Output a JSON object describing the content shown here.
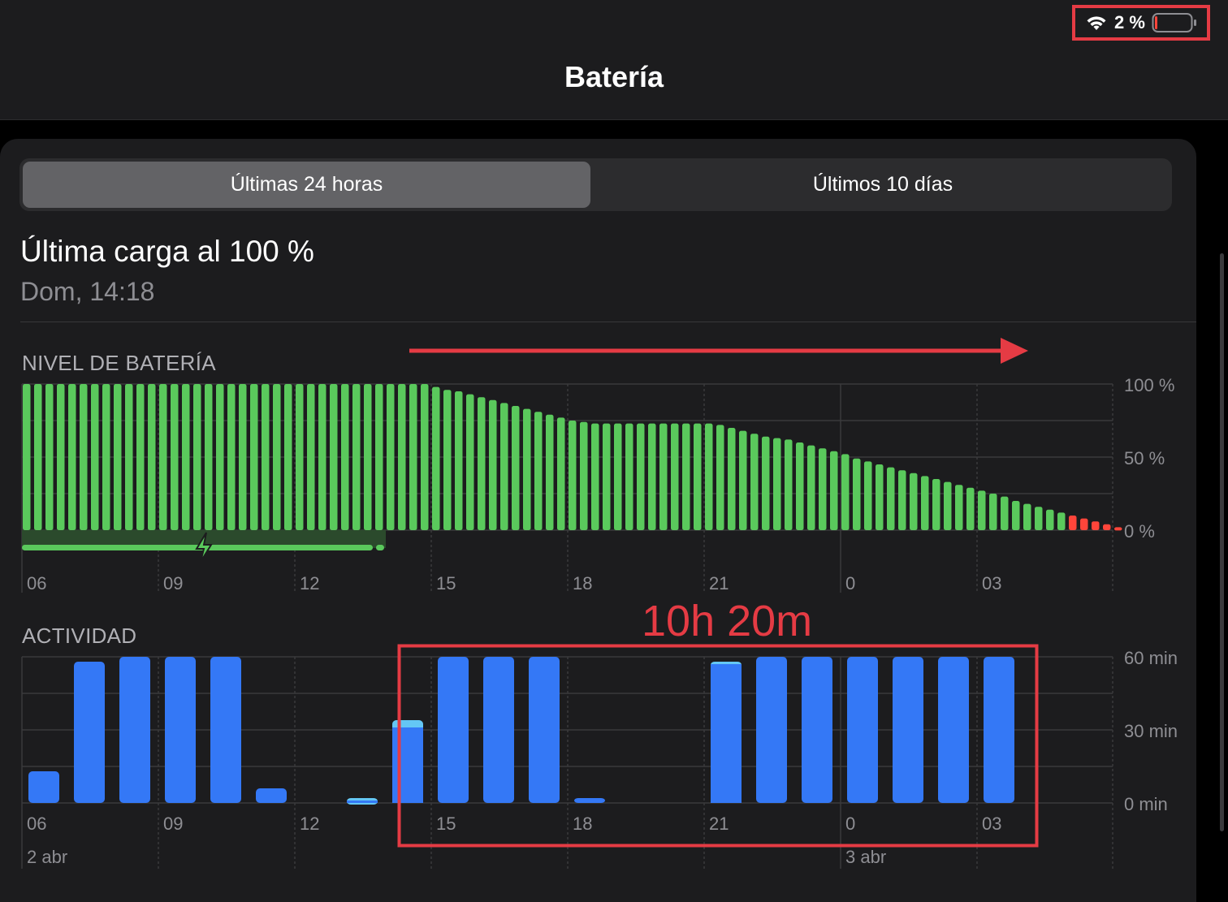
{
  "status_bar": {
    "battery_pct": "2 %",
    "wifi_icon": "wifi-icon",
    "battery_icon": "battery-low-icon"
  },
  "header": {
    "title": "Batería"
  },
  "tabs": {
    "last24": "Últimas 24 horas",
    "last10": "Últimos 10 días"
  },
  "summary": {
    "last_charge": "Última carga al 100 %",
    "date": "Dom, 14:18"
  },
  "annotation": {
    "duration": "10h 20m"
  },
  "colors": {
    "green": "#5ac95c",
    "red": "#ff453a",
    "blue": "#3478f6",
    "light_blue": "#64c7f5",
    "annotation_red": "#e53b44"
  },
  "chart_data": [
    {
      "type": "bar",
      "title": "NIVEL DE BATERÍA",
      "x_ticks": [
        "06",
        "09",
        "12",
        "15",
        "18",
        "21",
        "0",
        "03"
      ],
      "y_ticks": [
        "100 %",
        "50 %",
        "0 %"
      ],
      "ylim": [
        0,
        100
      ],
      "interval_minutes": 15,
      "start_label": "06",
      "charging_range": {
        "start_hour": 6.0,
        "end_hour": 14.0
      },
      "values": [
        100,
        100,
        100,
        100,
        100,
        100,
        100,
        100,
        100,
        100,
        100,
        100,
        100,
        100,
        100,
        100,
        100,
        100,
        100,
        100,
        100,
        100,
        100,
        100,
        100,
        100,
        100,
        100,
        100,
        100,
        100,
        100,
        100,
        100,
        100,
        100,
        98,
        96,
        95,
        93,
        91,
        89,
        87,
        85,
        83,
        81,
        79,
        77,
        75,
        74,
        73,
        73,
        73,
        73,
        73,
        73,
        73,
        73,
        73,
        73,
        73,
        72,
        70,
        68,
        66,
        64,
        63,
        62,
        60,
        58,
        56,
        54,
        52,
        49,
        47,
        45,
        43,
        41,
        39,
        37,
        35,
        33,
        31,
        29,
        27,
        25,
        23,
        20,
        18,
        16,
        14,
        12,
        10,
        8,
        6,
        4,
        2
      ],
      "low_threshold": 10
    },
    {
      "type": "bar",
      "title": "ACTIVIDAD",
      "x_ticks": [
        "06",
        "09",
        "12",
        "15",
        "18",
        "21",
        "0",
        "03"
      ],
      "y_ticks": [
        "60 min",
        "30 min",
        "0 min"
      ],
      "ylim": [
        0,
        60
      ],
      "date_labels": [
        "2 abr",
        "3 abr"
      ],
      "series": [
        {
          "name": "screen_on",
          "values": [
            13,
            58,
            60,
            60,
            60,
            6,
            0,
            1,
            31,
            60,
            60,
            60,
            2,
            0,
            0,
            57,
            60,
            60,
            60,
            60,
            60,
            60
          ]
        },
        {
          "name": "screen_off",
          "values": [
            0,
            0,
            0,
            0,
            0,
            0,
            0,
            1,
            3,
            0,
            0,
            0,
            0,
            0,
            0,
            1,
            0,
            0,
            0,
            0,
            0,
            0
          ]
        }
      ]
    }
  ]
}
